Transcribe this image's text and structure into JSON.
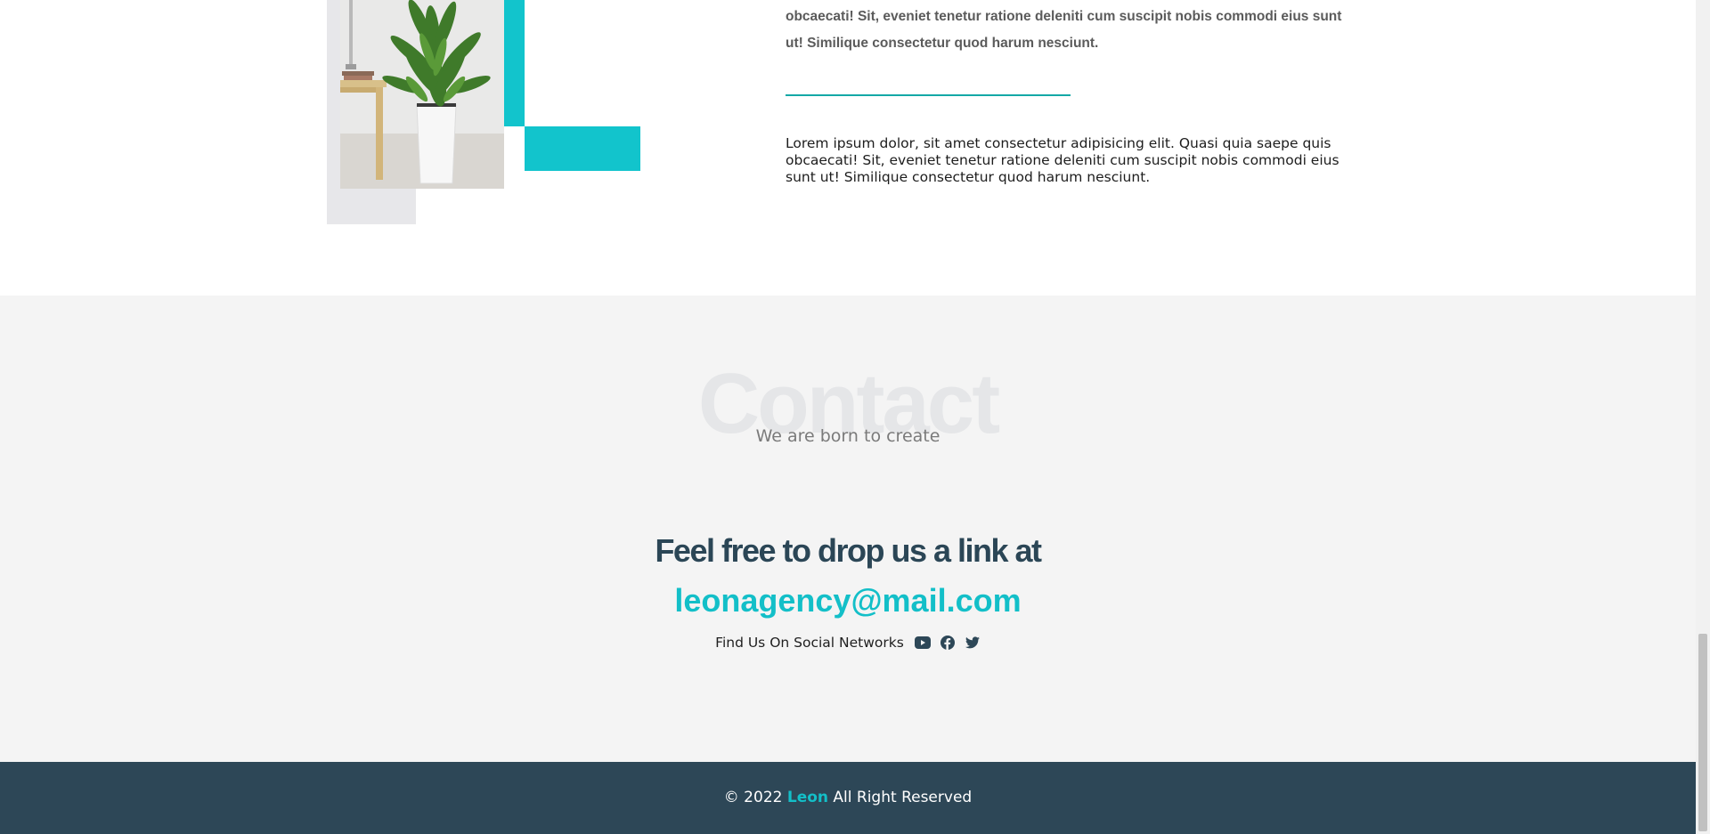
{
  "about": {
    "bold_paragraph": "obcaecati! Sit, eveniet tenetur ratione deleniti cum suscipit nobis commodi eius sunt ut! Similique consectetur quod harum nesciunt.",
    "paragraph": "Lorem ipsum dolor, sit amet consectetur adipisicing elit. Quasi quia saepe quis obcaecati! Sit, eveniet tenetur ratione deleniti cum suscipit nobis commodi eius sunt ut! Similique consectetur quod harum nesciunt."
  },
  "contact": {
    "background_title": "Contact",
    "subtitle": "We are born to create",
    "heading": "Feel free to drop us a link at",
    "email": "leonagency@mail.com",
    "social_label": "Find Us On Social Networks",
    "social_icons": [
      "youtube-icon",
      "facebook-icon",
      "twitter-icon"
    ]
  },
  "footer": {
    "copyright_prefix": "© 2022",
    "brand": "Leon",
    "copyright_suffix": "All Right Reserved"
  },
  "colors": {
    "accent": "#13bfc8",
    "dark": "#2d4757",
    "section_bg": "#f4f4f4"
  }
}
